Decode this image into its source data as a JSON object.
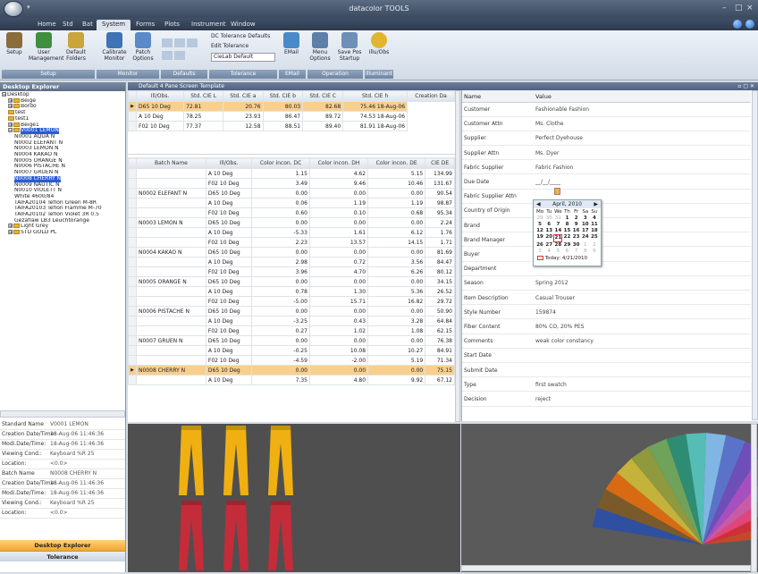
{
  "window": {
    "title": "datacolor TOOLS",
    "controls": [
      "–",
      "□",
      "×"
    ]
  },
  "menu": {
    "tabs": [
      "Home",
      "Std",
      "Bat",
      "System",
      "Forms",
      "Plots",
      "Instrument",
      "Window"
    ],
    "active": "System"
  },
  "ribbon": {
    "buttons": [
      {
        "label": "Setup",
        "color": "#8a6d3b"
      },
      {
        "label": "User Management",
        "color": "#3f8f3f"
      },
      {
        "label": "Default Folders",
        "color": "#c9a63b"
      },
      {
        "label": "Calibrate Monitor",
        "color": "#3e73b5"
      },
      {
        "label": "Patch Options",
        "color": "#5a8ac8"
      },
      {
        "label": "EMail",
        "color": "#4a8ac8"
      },
      {
        "label": "Menu Options",
        "color": "#5d7fa8"
      },
      {
        "label": "Save Pos Startup",
        "color": "#6d8fb8"
      },
      {
        "label": "Illu/Obs",
        "color": "#e0b62e"
      }
    ],
    "tolerance_items": [
      "DC Tolerance Defaults",
      "Edit Tolerance",
      "CieLab Default"
    ],
    "groups": [
      "Setup",
      "Monitor",
      "Defaults",
      "Tolerance",
      "EMail",
      "Operation",
      "Illuminant"
    ]
  },
  "explorer": {
    "title": "Desktop Explorer",
    "tree": [
      {
        "indent": 0,
        "label": "Desktop",
        "pm": "⊟",
        "folder": false
      },
      {
        "indent": 1,
        "label": "Beige",
        "pm": "⊞",
        "folder": true
      },
      {
        "indent": 1,
        "label": "Bordo",
        "pm": "⊞",
        "folder": true
      },
      {
        "indent": 1,
        "label": "test",
        "pm": "",
        "folder": true
      },
      {
        "indent": 1,
        "label": "test1",
        "pm": "",
        "folder": true
      },
      {
        "indent": 1,
        "label": "Beige1",
        "pm": "⊞",
        "folder": true
      },
      {
        "indent": 1,
        "label": "V0001 LEMON",
        "pm": "⊟",
        "folder": true,
        "selected": true
      },
      {
        "indent": 2,
        "label": "N0001 AQUA N",
        "pm": "",
        "folder": false
      },
      {
        "indent": 2,
        "label": "N0002 ELEFANT N",
        "pm": "",
        "folder": false
      },
      {
        "indent": 2,
        "label": "N0003 LEMON N",
        "pm": "",
        "folder": false
      },
      {
        "indent": 2,
        "label": "N0004 KAKAO N",
        "pm": "",
        "folder": false
      },
      {
        "indent": 2,
        "label": "N0005 ORANGE N",
        "pm": "",
        "folder": false
      },
      {
        "indent": 2,
        "label": "N0006 PISTACHE N",
        "pm": "",
        "folder": false
      },
      {
        "indent": 2,
        "label": "N0007 GRUEN N",
        "pm": "",
        "folder": false
      },
      {
        "indent": 2,
        "label": "N0008 CHERRY N",
        "pm": "",
        "folder": false,
        "selected": true
      },
      {
        "indent": 2,
        "label": "N0009 NAUTIC N",
        "pm": "",
        "folder": false
      },
      {
        "indent": 2,
        "label": "N0010 VIOLETT N",
        "pm": "",
        "folder": false
      },
      {
        "indent": 2,
        "label": "White 4600/84",
        "pm": "",
        "folder": false
      },
      {
        "indent": 2,
        "label": "TAIFA20104 Teflon Green M-8R",
        "pm": "",
        "folder": false
      },
      {
        "indent": 2,
        "label": "TAIFA20103 Teflon Flamme M-70",
        "pm": "",
        "folder": false
      },
      {
        "indent": 2,
        "label": "TAIFA20102 Teflon Violet 3R 0.5",
        "pm": "",
        "folder": false
      },
      {
        "indent": 2,
        "label": "Gezaflaw LB3 Leuchtorange",
        "pm": "",
        "folder": false
      },
      {
        "indent": 1,
        "label": "Light Grey",
        "pm": "⊞",
        "folder": true
      },
      {
        "indent": 1,
        "label": "STD GOLD PL",
        "pm": "⊞",
        "folder": true
      }
    ],
    "props": [
      {
        "k": "Standard Name",
        "v": "V0001 LEMON"
      },
      {
        "k": "Creation Date/Time:",
        "v": "18-Aug-06 11:46:36"
      },
      {
        "k": "Modi.Date/Time:",
        "v": "18-Aug-06 11:46:36"
      },
      {
        "k": "Viewing Cond.:",
        "v": "Keyboard %R 25"
      },
      {
        "k": "Location:",
        "v": "<0.0>"
      },
      {
        "k": "Batch Name",
        "v": "N0008 CHERRY N"
      },
      {
        "k": "Creation Date/Time:",
        "v": "18-Aug-06 11:46:36"
      },
      {
        "k": "Modi.Date/Time:",
        "v": "18-Aug-06 11:46:36"
      },
      {
        "k": "Viewing Cond.:",
        "v": "Keyboard %R 25"
      },
      {
        "k": "Location:",
        "v": "<0.0>"
      }
    ],
    "nav": {
      "explorer": "Desktop Explorer",
      "tolerance": "Tolerance"
    }
  },
  "tab_title": "Default 4 Pane Screen Template",
  "std_table": {
    "headers": [
      "Ill/Obs.",
      "Std. CIE L",
      "Std. CIE a",
      "Std. CIE b",
      "Std. CIE C",
      "Std. CIE h",
      "Creation Da"
    ],
    "rows": [
      {
        "hl": true,
        "c": [
          "D65 10 Deg",
          "72.81",
          "20.76",
          "80.03",
          "82.68",
          "75.46 18-Aug-06"
        ]
      },
      {
        "hl": false,
        "c": [
          "A 10 Deg",
          "78.25",
          "23.93",
          "86.47",
          "89.72",
          "74.53 18-Aug-06"
        ]
      },
      {
        "hl": false,
        "c": [
          "F02 10 Deg",
          "77.37",
          "12.58",
          "88.51",
          "89.40",
          "81.91 18-Aug-06"
        ]
      }
    ]
  },
  "batch_table": {
    "headers": [
      "Batch Name",
      "Ill/Obs.",
      "Color incon. DC",
      "Color incon. DH",
      "Color incon. DE",
      "CIE DE"
    ],
    "rows": [
      {
        "hl": false,
        "c": [
          "",
          "A 10 Deg",
          "1.15",
          "4.62",
          "5.15",
          "134.99"
        ]
      },
      {
        "hl": false,
        "c": [
          "",
          "F02 10 Deg",
          "3.49",
          "9.46",
          "10.46",
          "131.67"
        ]
      },
      {
        "hl": false,
        "c": [
          "N0002 ELEFANT N",
          "D65 10 Deg",
          "0.00",
          "0.00",
          "0.00",
          "90.54"
        ]
      },
      {
        "hl": false,
        "c": [
          "",
          "A 10 Deg",
          "0.06",
          "1.19",
          "1.19",
          "98.87"
        ]
      },
      {
        "hl": false,
        "c": [
          "",
          "F02 10 Deg",
          "0.60",
          "0.10",
          "0.68",
          "95.34"
        ]
      },
      {
        "hl": false,
        "c": [
          "N0003 LEMON N",
          "D65 10 Deg",
          "0.00",
          "0.00",
          "0.00",
          "2.24"
        ]
      },
      {
        "hl": false,
        "c": [
          "",
          "A 10 Deg",
          "-5.33",
          "1.61",
          "6.12",
          "1.76"
        ]
      },
      {
        "hl": false,
        "c": [
          "",
          "F02 10 Deg",
          "2.23",
          "13.57",
          "14.15",
          "1.71"
        ]
      },
      {
        "hl": false,
        "c": [
          "N0004 KAKAO N",
          "D65 10 Deg",
          "0.00",
          "0.00",
          "0.00",
          "81.69"
        ]
      },
      {
        "hl": false,
        "c": [
          "",
          "A 10 Deg",
          "2.98",
          "0.72",
          "3.56",
          "84.47"
        ]
      },
      {
        "hl": false,
        "c": [
          "",
          "F02 10 Deg",
          "3.96",
          "4.70",
          "6.26",
          "80.12"
        ]
      },
      {
        "hl": false,
        "c": [
          "N0005 ORANGE N",
          "D65 10 Deg",
          "0.00",
          "0.00",
          "0.00",
          "34.15"
        ]
      },
      {
        "hl": false,
        "c": [
          "",
          "A 10 Deg",
          "0.78",
          "1.30",
          "5.36",
          "26.52"
        ]
      },
      {
        "hl": false,
        "c": [
          "",
          "F02 10 Deg",
          "-5.00",
          "15.71",
          "16.82",
          "29.72"
        ]
      },
      {
        "hl": false,
        "c": [
          "N0006 PISTACHE N",
          "D65 10 Deg",
          "0.00",
          "0.00",
          "0.00",
          "50.90"
        ]
      },
      {
        "hl": false,
        "c": [
          "",
          "A 10 Deg",
          "-3.25",
          "0.43",
          "3.28",
          "64.84"
        ]
      },
      {
        "hl": false,
        "c": [
          "",
          "F02 10 Deg",
          "0.27",
          "1.02",
          "1.08",
          "62.15"
        ]
      },
      {
        "hl": false,
        "c": [
          "N0007 GRUEN N",
          "D65 10 Deg",
          "0.00",
          "0.00",
          "0.00",
          "76.38"
        ]
      },
      {
        "hl": false,
        "c": [
          "",
          "A 10 Deg",
          "-0.25",
          "10.08",
          "10.27",
          "84.91"
        ]
      },
      {
        "hl": false,
        "c": [
          "",
          "F02 10 Deg",
          "-4.59",
          "-2.00",
          "5.19",
          "71.34"
        ]
      },
      {
        "hl": true,
        "c": [
          "N0008 CHERRY N",
          "D65 10 Deg",
          "0.00",
          "0.00",
          "0.00",
          "75.15"
        ]
      },
      {
        "hl": false,
        "c": [
          "",
          "A 10 Deg",
          "7.35",
          "4.80",
          "9.92",
          "67.12"
        ]
      }
    ]
  },
  "details": {
    "headers": [
      "Name",
      "Value"
    ],
    "rows": [
      {
        "k": "Customer",
        "v": "Fashionable Fashion"
      },
      {
        "k": "Customer Attn",
        "v": "Ms. Clothe"
      },
      {
        "k": "Supplier",
        "v": "Perfect Dyehouse"
      },
      {
        "k": "Supplier Attn",
        "v": "Ms. Dyer"
      },
      {
        "k": "Fabric Supplier",
        "v": "Fabric Fashion"
      },
      {
        "k": "Due Date",
        "v": "__/__/____"
      },
      {
        "k": "Fabric Supplier Attn",
        "v": ""
      },
      {
        "k": "Country of Origin",
        "v": ""
      },
      {
        "k": "Brand",
        "v": ""
      },
      {
        "k": "Brand Manager",
        "v": ""
      },
      {
        "k": "Buyer",
        "v": ""
      },
      {
        "k": "Department",
        "v": ""
      },
      {
        "k": "Season",
        "v": "Spring 2012"
      },
      {
        "k": "Item Description",
        "v": "Casual Trouser"
      },
      {
        "k": "Style Number",
        "v": "159874"
      },
      {
        "k": "Fiber Content",
        "v": "80% CO, 20% PES"
      },
      {
        "k": "Comments",
        "v": "weak color constancy"
      },
      {
        "k": "Start Date",
        "v": ""
      },
      {
        "k": "Submit Date",
        "v": ""
      },
      {
        "k": "Type",
        "v": "first swatch"
      },
      {
        "k": "Decision",
        "v": "reject"
      }
    ]
  },
  "calendar": {
    "month": "April, 2010",
    "dow": [
      "Mo",
      "Tu",
      "We",
      "Th",
      "Fr",
      "Sa",
      "Su"
    ],
    "days": [
      "29",
      "30",
      "31",
      "1",
      "2",
      "3",
      "4",
      "5",
      "6",
      "7",
      "8",
      "9",
      "10",
      "11",
      "12",
      "13",
      "14",
      "15",
      "16",
      "17",
      "18",
      "19",
      "20",
      "21",
      "22",
      "23",
      "24",
      "25",
      "26",
      "27",
      "28",
      "29",
      "30",
      "1",
      "2",
      "3",
      "4",
      "5",
      "6",
      "7",
      "8",
      "9"
    ],
    "today_label": "Today: 4/21/2010"
  },
  "trousers": {
    "colors": [
      "#f0b011",
      "#f0b011",
      "#f0b011",
      "#c42c3a",
      "#c42c3a",
      "#c42c3a"
    ]
  },
  "fan": {
    "colors": [
      "#2f4fa0",
      "#7a5a2a",
      "#d96a14",
      "#c5b23a",
      "#8f9a3f",
      "#6fa25a",
      "#2e8c73",
      "#55bdb5",
      "#7fb6e4",
      "#5a73c8",
      "#6e4fb8",
      "#a64fc0",
      "#c95aa8",
      "#e2457a",
      "#cf2f38",
      "#c24a2a"
    ]
  }
}
